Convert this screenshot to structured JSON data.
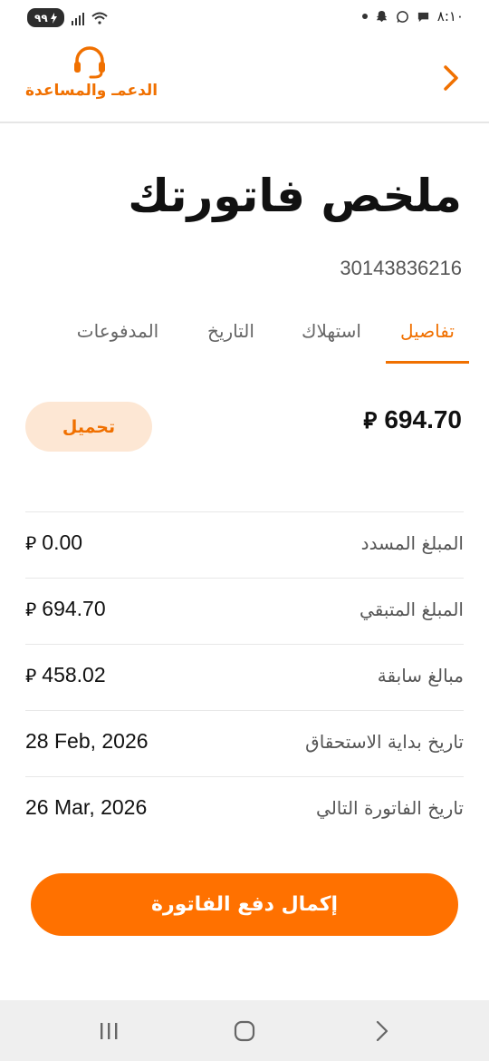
{
  "status_bar": {
    "time": "٨:١٠",
    "battery": "٩٩",
    "icons": [
      "dot-icon",
      "snapchat-icon",
      "whatsapp-icon",
      "message-icon"
    ]
  },
  "header": {
    "support_label": "الدعمـ والمساعدة",
    "support_icon": "headset-icon",
    "back_icon": "chevron-right-icon"
  },
  "page": {
    "title": "ملخص فاتورتك",
    "account_number": "30143836216"
  },
  "tabs": [
    {
      "label": "تفاصيل",
      "active": true
    },
    {
      "label": "استهلاك",
      "active": false
    },
    {
      "label": "التاريخ",
      "active": false
    },
    {
      "label": "المدفوعات",
      "active": false
    }
  ],
  "summary": {
    "total_amount": "694.70",
    "currency_symbol": "⃁",
    "download_label": "تحميل"
  },
  "details": [
    {
      "label": "المبلغ المسدد",
      "value": "0.00",
      "currency": true
    },
    {
      "label": "المبلغ المتبقي",
      "value": "694.70",
      "currency": true
    },
    {
      "label": "مبالغ سابقة",
      "value": "458.02",
      "currency": true
    },
    {
      "label": "تاريخ بداية الاستحقاق",
      "value": "28 Feb, 2026",
      "currency": false
    },
    {
      "label": "تاريخ الفاتورة التالي",
      "value": "26 Mar, 2026",
      "currency": false
    }
  ],
  "cta": {
    "label": "إكمال دفع الفاتورة"
  },
  "colors": {
    "accent": "#ff7100",
    "accent_light": "#fde7d4"
  }
}
